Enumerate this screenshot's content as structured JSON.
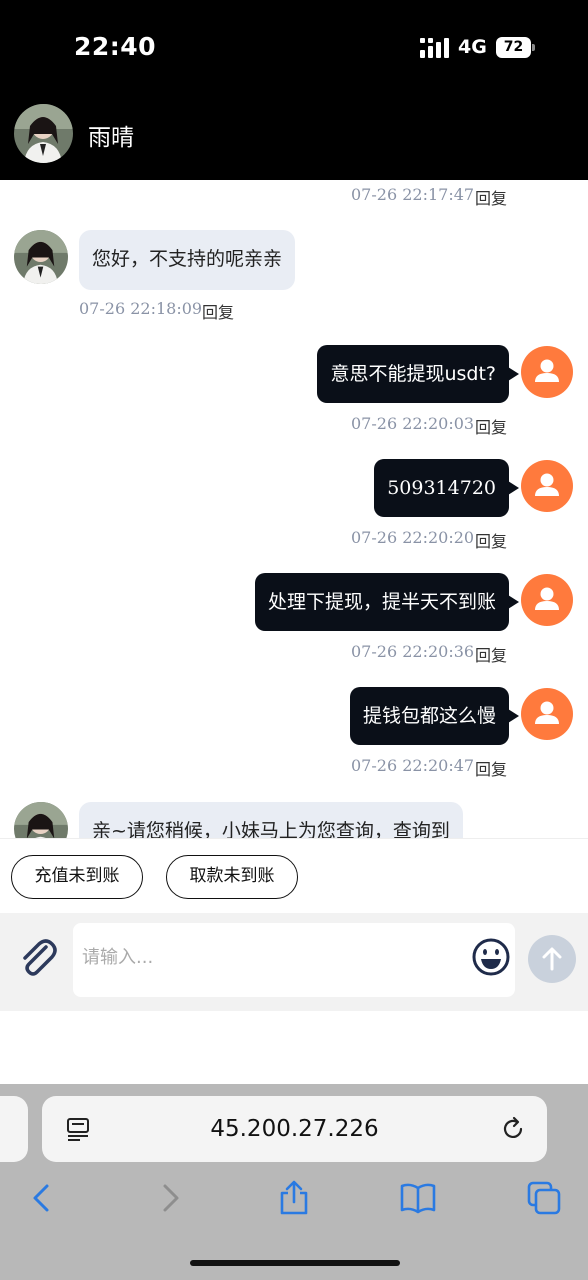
{
  "status_bar": {
    "time": "22:40",
    "network": "4G",
    "battery": "72"
  },
  "header": {
    "name": "雨晴"
  },
  "colors": {
    "user_avatar": "#ff7a3d",
    "outgoing_bubble": "#0a0f18",
    "incoming_bubble": "#e9edf4",
    "timestamp": "#8a93a6"
  },
  "messages": [
    {
      "side": "out",
      "text": "",
      "time": "07-26 22:17:47",
      "reply": "回复"
    },
    {
      "side": "in",
      "text": "您好，不支持的呢亲亲",
      "time": "07-26 22:18:09",
      "reply": "回复"
    },
    {
      "side": "out",
      "text": "意思不能提现usdt?",
      "time": "07-26 22:20:03",
      "reply": "回复"
    },
    {
      "side": "out",
      "text": "509314720",
      "time": "07-26 22:20:20",
      "reply": "回复"
    },
    {
      "side": "out",
      "text": "处理下提现，提半天不到账",
      "time": "07-26 22:20:36",
      "reply": "回复"
    },
    {
      "side": "out",
      "text": "提钱包都这么慢",
      "time": "07-26 22:20:47",
      "reply": "回复"
    },
    {
      "side": "in",
      "text": "亲~请您稍候，小妹马上为您查询，查询到",
      "time": "",
      "reply": ""
    }
  ],
  "quick_replies": [
    "充值未到账",
    "取款未到账"
  ],
  "input": {
    "placeholder": "请输入..."
  },
  "browser": {
    "url": "45.200.27.226"
  },
  "icons": {
    "attach": "paperclip-icon",
    "emoji": "smiley-icon",
    "send": "arrow-up-icon",
    "reader": "reader-mode-icon",
    "reload": "reload-icon",
    "back": "chevron-left-icon",
    "forward": "chevron-right-icon",
    "share": "share-icon",
    "bookmarks": "book-icon",
    "tabs": "tabs-icon"
  }
}
